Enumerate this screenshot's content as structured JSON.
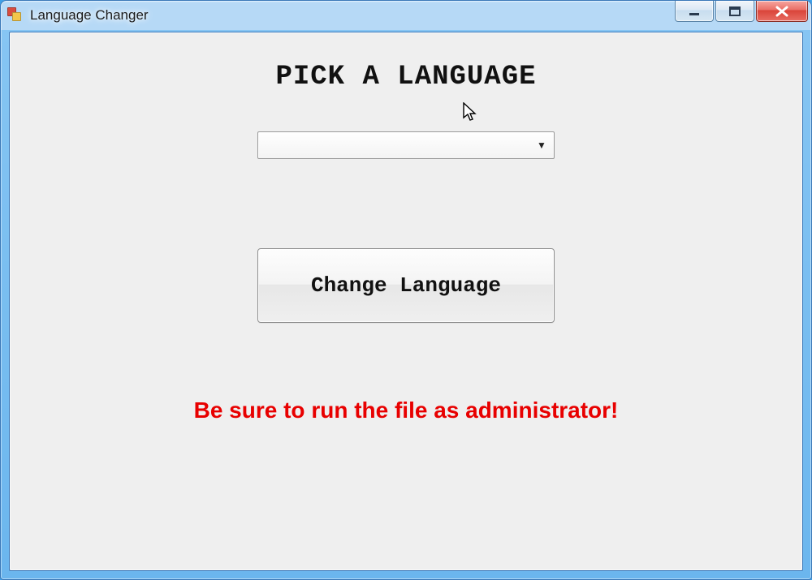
{
  "window": {
    "title": "Language Changer"
  },
  "content": {
    "heading": "PICK A LANGUAGE",
    "dropdown_value": "",
    "button_label": "Change Language",
    "warning": "Be sure to run the file as administrator!"
  }
}
